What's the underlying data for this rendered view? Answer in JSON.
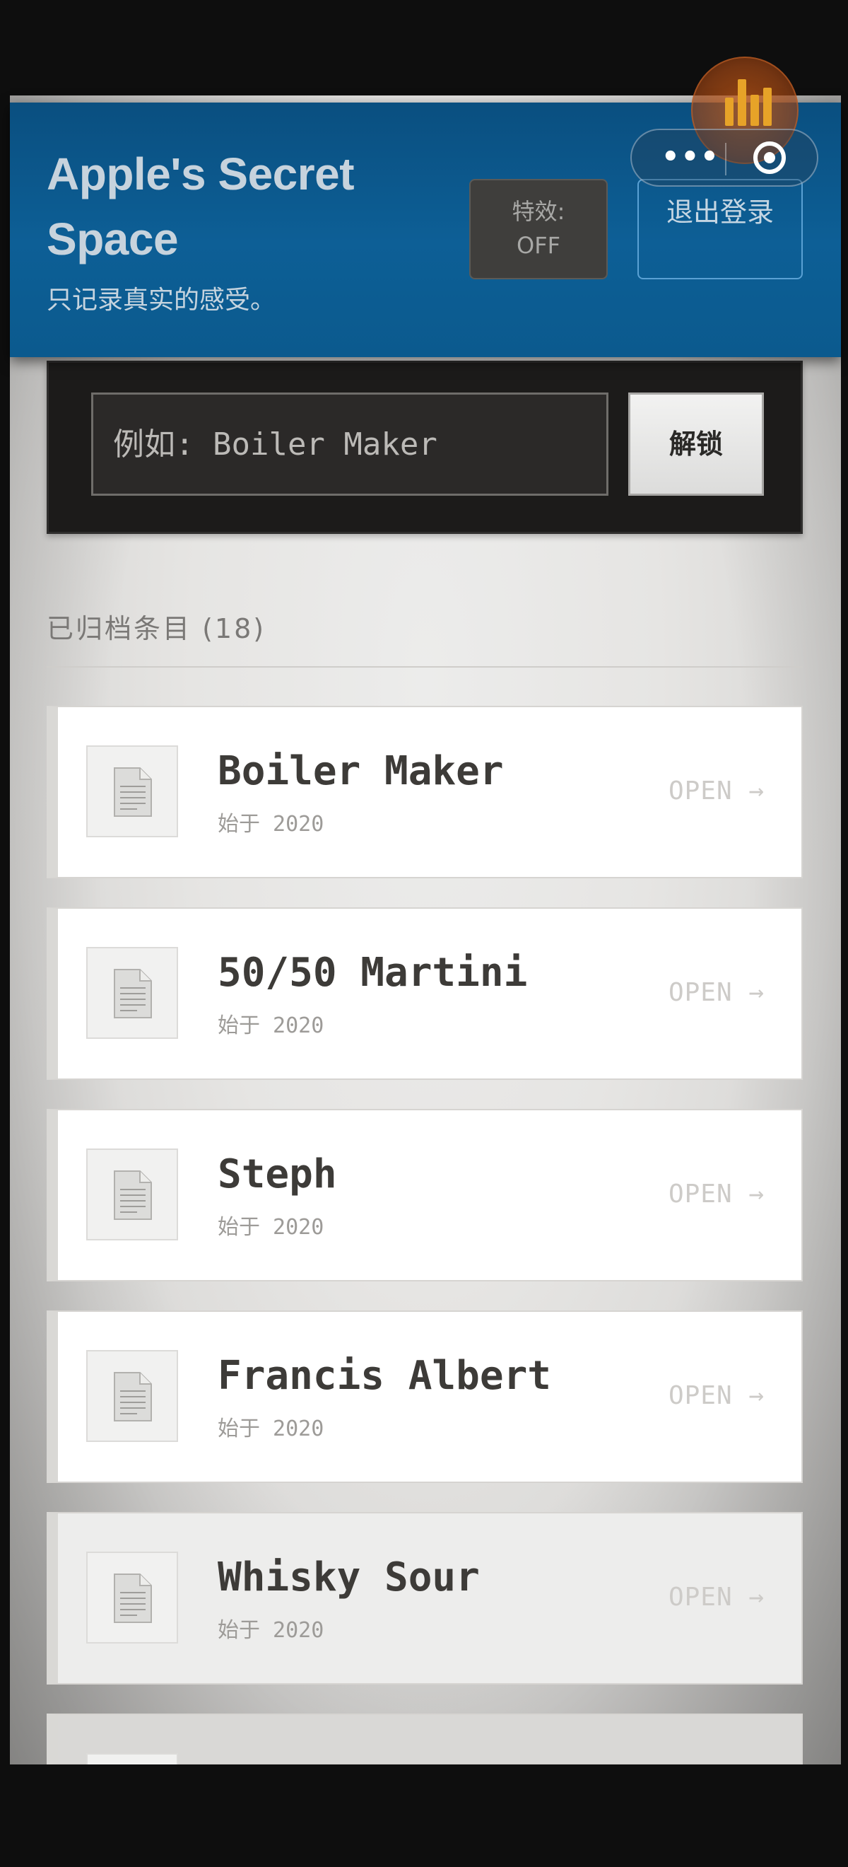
{
  "header": {
    "title_line1": "Apple's Secret",
    "title_line2": "Space",
    "tagline": "只记录真实的感受。",
    "fx_label_line1": "特效:",
    "fx_label_line2": "OFF",
    "logout_label": "退出登录"
  },
  "search": {
    "placeholder": "例如: Boiler Maker",
    "unlock_label": "解锁"
  },
  "archive": {
    "title": "已归档条目 (18)"
  },
  "entries": [
    {
      "name": "Boiler Maker",
      "since": "始于 2020",
      "open": "OPEN →"
    },
    {
      "name": "50/50 Martini",
      "since": "始于 2020",
      "open": "OPEN →"
    },
    {
      "name": "Steph",
      "since": "始于 2020",
      "open": "OPEN →"
    },
    {
      "name": "Francis Albert",
      "since": "始于 2020",
      "open": "OPEN →"
    },
    {
      "name": "Whisky Sour",
      "since": "始于 2020",
      "open": "OPEN →"
    }
  ],
  "icons": {
    "capsule_more": "more-dots-icon",
    "capsule_close": "target-close-icon",
    "music": "music-bars-icon",
    "document": "document-icon"
  },
  "colors": {
    "header_blue": "#0d5f96",
    "music_orange": "#e7a328",
    "panel_dark": "#1c1b1a"
  }
}
